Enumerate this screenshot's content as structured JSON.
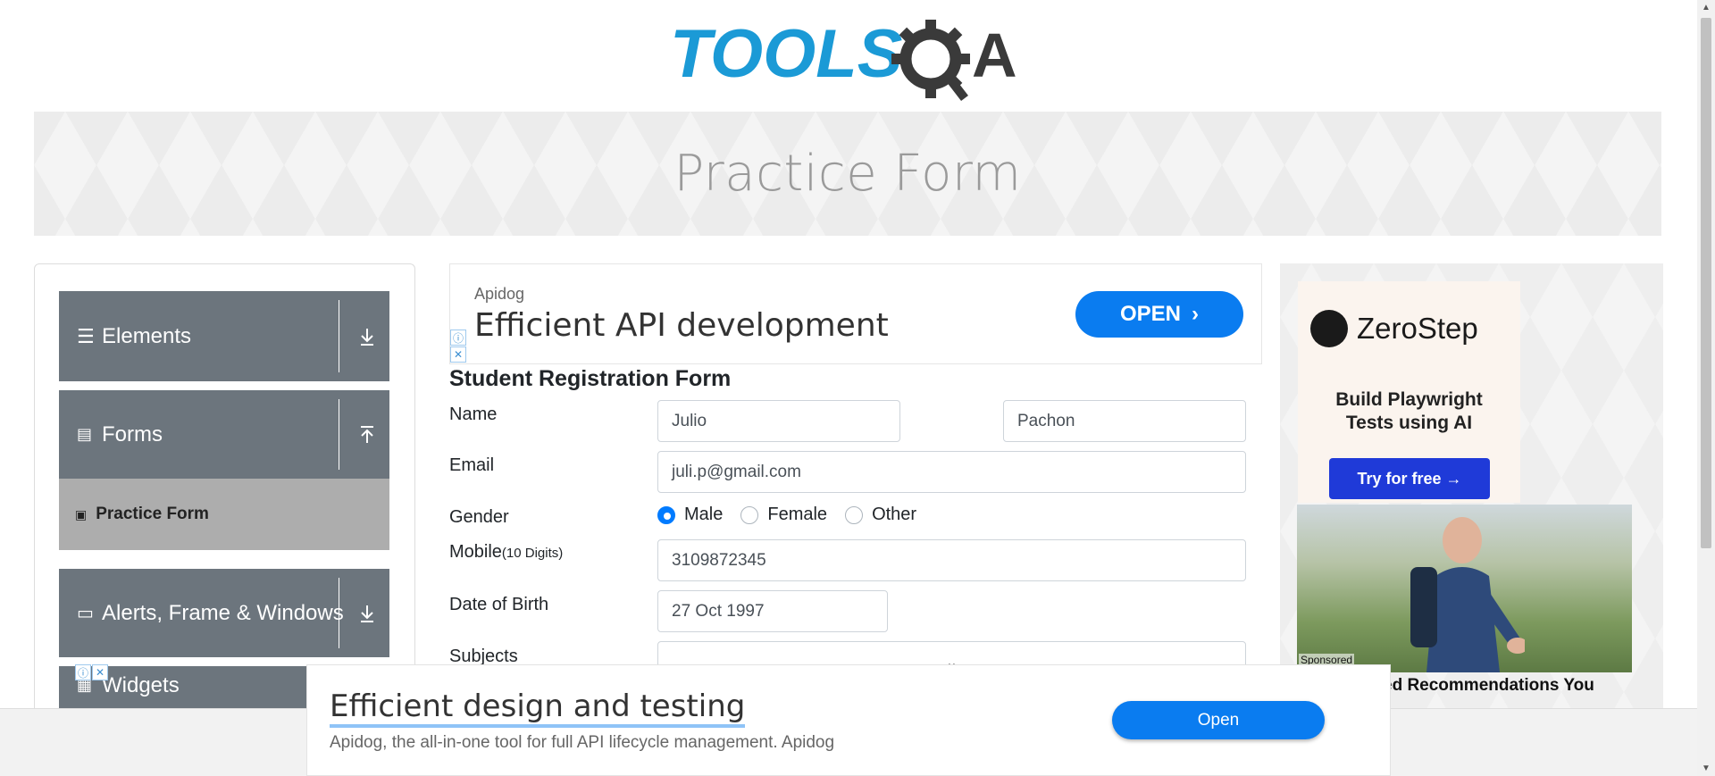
{
  "header": {
    "logo_text": "TOOLSQA"
  },
  "banner": {
    "title": "Practice Form"
  },
  "sidebar": {
    "groups": [
      {
        "label": "Elements",
        "icon": "menu-icon",
        "arrow": "download-arrow-icon"
      },
      {
        "label": "Forms",
        "icon": "document-icon",
        "arrow": "upload-arrow-icon"
      },
      {
        "label": "Alerts, Frame & Windows",
        "icon": "window-icon",
        "arrow": "download-arrow-icon"
      },
      {
        "label": "Widgets",
        "icon": "widgets-icon",
        "arrow": "download-arrow-icon"
      }
    ],
    "active_item": {
      "label": "Practice Form",
      "icon": "form-icon"
    }
  },
  "ad_top": {
    "brand": "Apidog",
    "headline": "Efficient API development",
    "button": "OPEN"
  },
  "form": {
    "title": "Student Registration Form",
    "name_label": "Name",
    "first_name": "Julio",
    "last_name": "Pachon",
    "email_label": "Email",
    "email": "juli.p@gmail.com",
    "gender_label": "Gender",
    "gender_options": [
      "Male",
      "Female",
      "Other"
    ],
    "gender_selected": "Male",
    "mobile_label": "Mobile",
    "mobile_hint": "(10 Digits)",
    "mobile": "3109872345",
    "dob_label": "Date of Birth",
    "dob": "27 Oct 1997",
    "subjects_label": "Subjects"
  },
  "ad_right": {
    "brand": "ZeroStep",
    "tagline_1": "Build Playwright",
    "tagline_2": "Tests using AI",
    "button": "Try for free →",
    "sponsored": "Sponsored",
    "rec_text": "ed Recommendations You"
  },
  "ad_bottom": {
    "headline": "Efficient design and testing",
    "description": "Apidog, the all-in-one tool for full API lifecycle management. Apidog",
    "button": "Open"
  },
  "colors": {
    "sidebar_group": "#6c757d",
    "sidebar_active": "#adadad",
    "primary": "#0a7cf0",
    "radio_checked": "#007bff",
    "logo_blue": "#1b9ad6",
    "logo_dark": "#3a3a3a"
  }
}
